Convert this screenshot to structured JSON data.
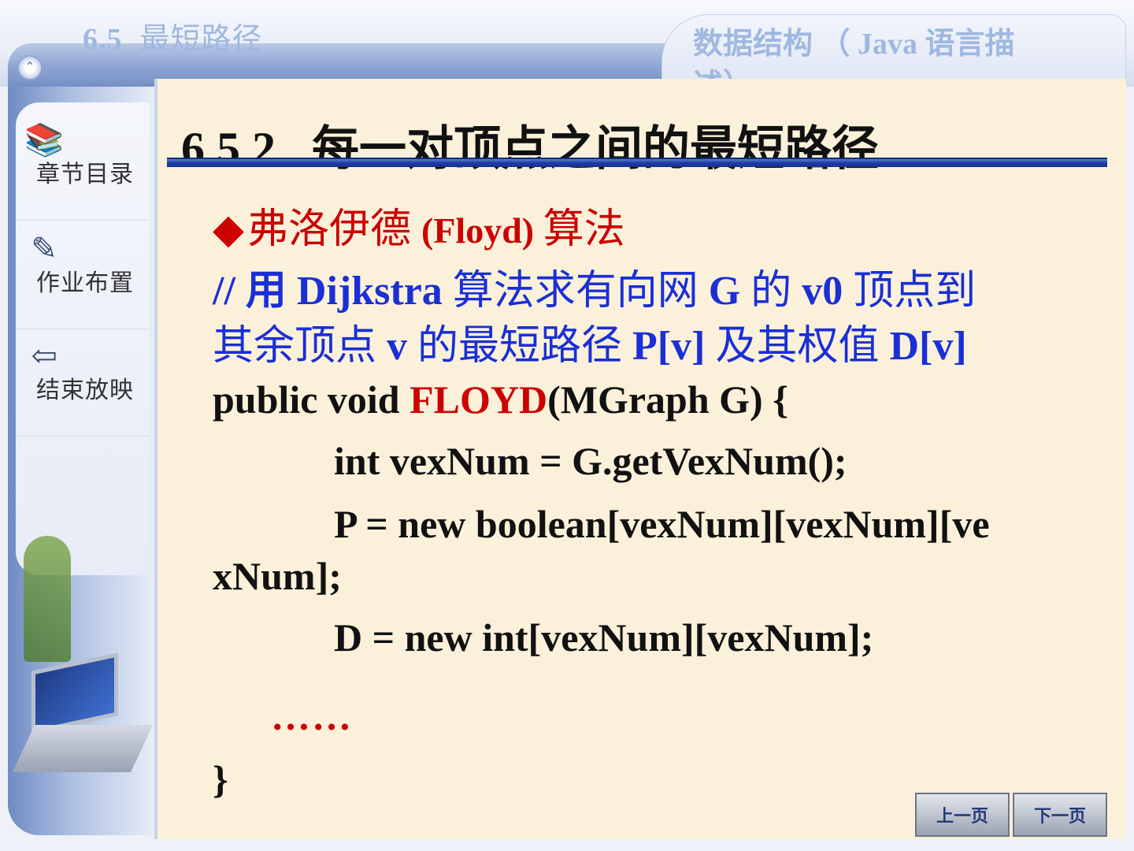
{
  "header": {
    "section_number": "6.5",
    "section_title": "最短路径",
    "course_title": "数据结构 （ Java 语言描述）"
  },
  "sidebar": {
    "items": [
      {
        "label": "章节目录",
        "icon": "book-icon"
      },
      {
        "label": "作业布置",
        "icon": "pencil-icon"
      },
      {
        "label": "结束放映",
        "icon": "exit-door-icon"
      }
    ]
  },
  "main": {
    "title_number": "6.5.2",
    "title_text": "每一对顶点之间的最短路径",
    "algorithm": {
      "bullet": "◆",
      "cn": "弗洛伊德 ",
      "en": "(Floyd) ",
      "cn2": "算法"
    },
    "comment_line1": {
      "p1": "//  用 ",
      "b1": "Dijkstra",
      "p2": " 算法求有向网 ",
      "b2": "G",
      "p3": " 的 ",
      "b3": "v0",
      "p4": " 顶点到"
    },
    "comment_line2": {
      "p1": "其余顶点 ",
      "b1": "v",
      "p2": " 的最短路径 ",
      "b2": "P[v]",
      "p3": " 及其权值 ",
      "b3": "D[v]"
    },
    "code": {
      "line1_pre": "public void ",
      "line1_fn": "FLOYD",
      "line1_post": "(MGraph G) {",
      "line2": "int vexNum = G.getVexNum();",
      "line3": "P = new boolean[vexNum][vexNum][ve",
      "line4": "xNum];",
      "line5": "D = new int[vexNum][vexNum];",
      "ellipsis": "……",
      "closing": "}"
    }
  },
  "navigation": {
    "prev_label": "上一页",
    "next_label": "下一页"
  },
  "colors": {
    "accent_blue": "#1a2fd6",
    "accent_red": "#cc0000",
    "content_bg": "#fbf1da"
  }
}
